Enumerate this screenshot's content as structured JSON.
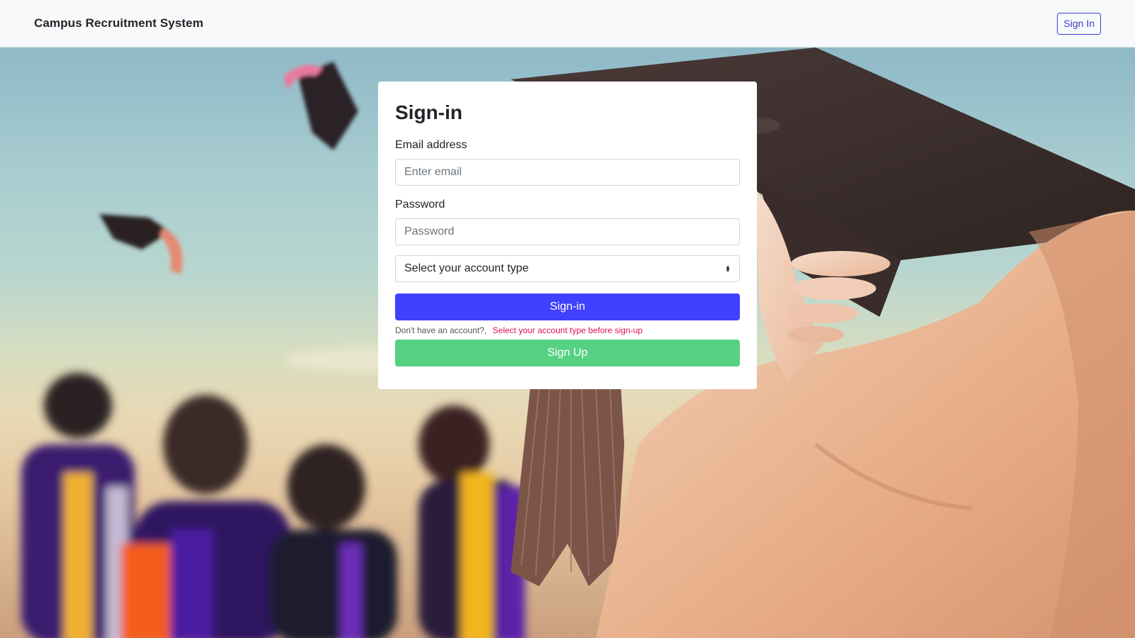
{
  "navbar": {
    "brand": "Campus Recruitment System",
    "signin_label": "Sign In"
  },
  "form": {
    "title": "Sign-in",
    "email_label": "Email address",
    "email_placeholder": "Enter email",
    "email_value": "",
    "password_label": "Password",
    "password_placeholder": "Password",
    "password_value": "",
    "account_type_selected": "Select your account type",
    "signin_button": "Sign-in",
    "no_account_text": "Don't have an account?,",
    "signup_hint": "Select your account type before sign-up",
    "signup_button": "Sign Up"
  },
  "colors": {
    "primary": "#4040ff",
    "success": "#56d184",
    "warning_text": "#e0104f",
    "navbar_bg": "#f8f9fa"
  },
  "icons": {
    "select_arrows": "up-down-caret-icon"
  }
}
